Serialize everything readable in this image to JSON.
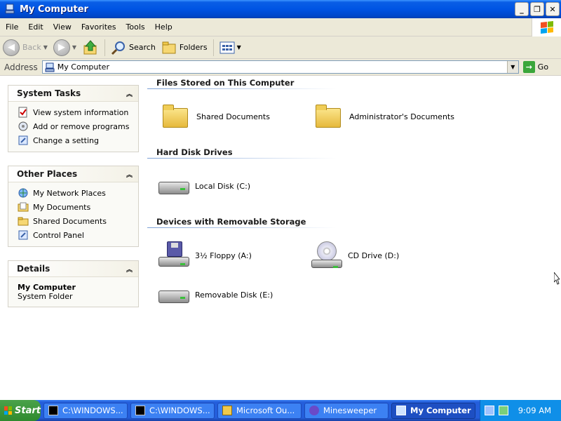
{
  "window": {
    "title": "My Computer"
  },
  "menu": [
    "File",
    "Edit",
    "View",
    "Favorites",
    "Tools",
    "Help"
  ],
  "toolbar": {
    "back": "Back",
    "search": "Search",
    "folders": "Folders"
  },
  "address": {
    "label": "Address",
    "value": "My Computer",
    "go": "Go"
  },
  "system_tasks": {
    "title": "System Tasks",
    "items": [
      "View system information",
      "Add or remove programs",
      "Change a setting"
    ]
  },
  "other_places": {
    "title": "Other Places",
    "items": [
      "My Network Places",
      "My Documents",
      "Shared Documents",
      "Control Panel"
    ]
  },
  "details": {
    "title": "Details",
    "name": "My Computer",
    "type": "System Folder"
  },
  "sections": {
    "files": {
      "title": "Files Stored on This Computer",
      "items": [
        "Shared Documents",
        "Administrator's Documents"
      ]
    },
    "hdd": {
      "title": "Hard Disk Drives",
      "items": [
        "Local Disk (C:)"
      ]
    },
    "removable": {
      "title": "Devices with Removable Storage",
      "items": [
        "3½ Floppy (A:)",
        "CD Drive (D:)",
        "Removable Disk (E:)"
      ]
    }
  },
  "taskbar": {
    "start": "Start",
    "tasks": [
      "C:\\WINDOWS...",
      "C:\\WINDOWS...",
      "Microsoft Ou...",
      "Minesweeper",
      "My Computer"
    ],
    "clock": "9:09 AM"
  }
}
